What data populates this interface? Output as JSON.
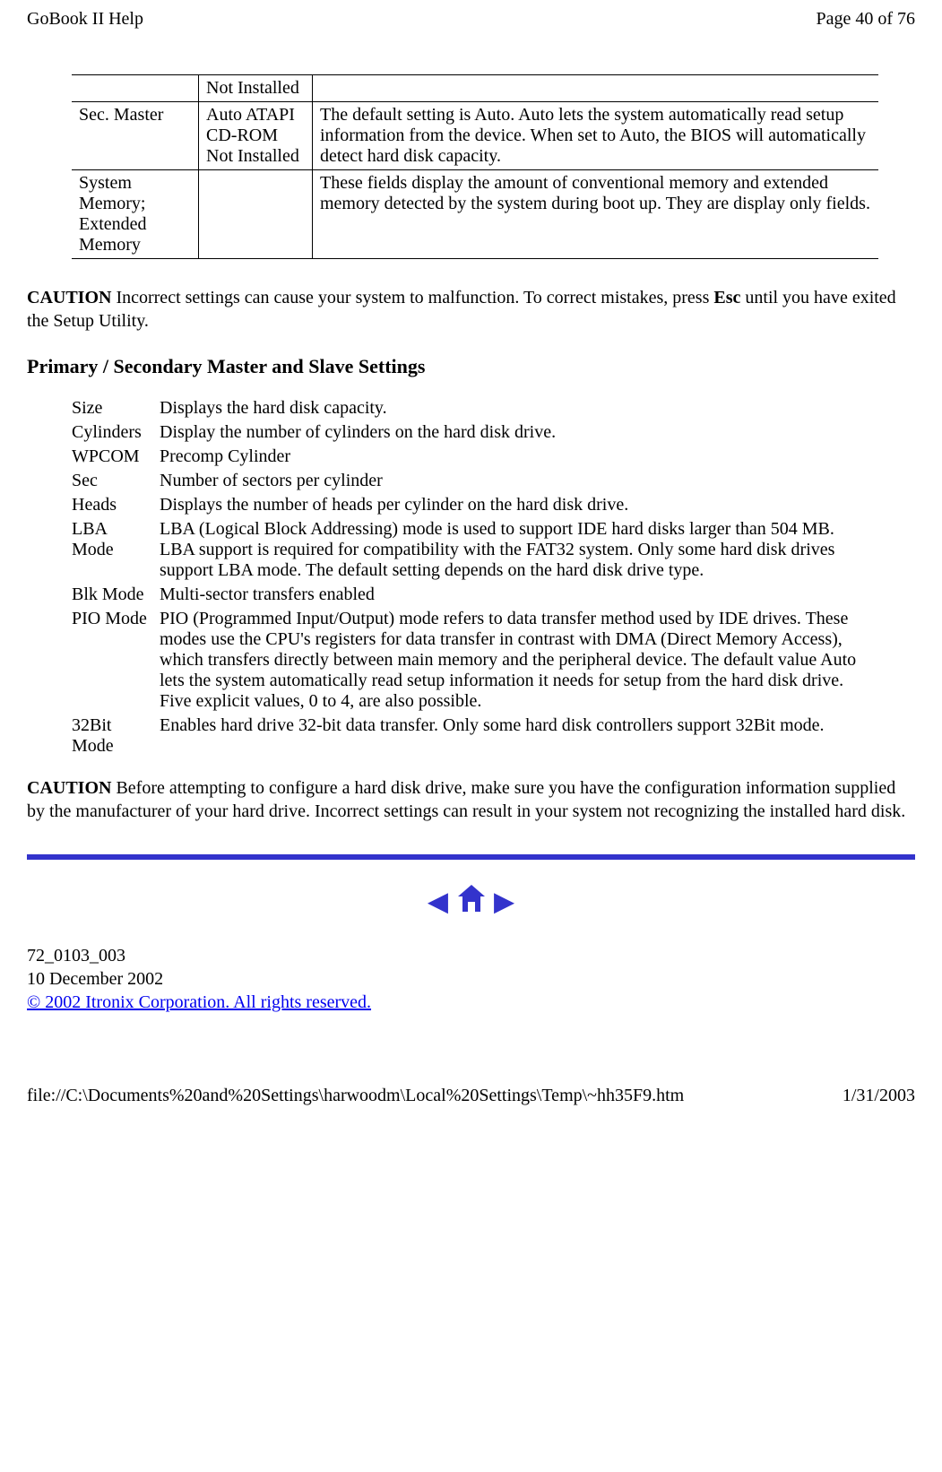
{
  "header": {
    "left": "GoBook II Help",
    "right": "Page 40 of 76"
  },
  "bios_table": {
    "rows": [
      {
        "col1": "",
        "col2": "Not Installed",
        "col3": ""
      },
      {
        "col1": "Sec. Master",
        "col2": "Auto ATAPI CD-ROM Not Installed",
        "col3": "The default setting is Auto.  Auto lets the system automatically read setup information from the device.  When set to Auto, the BIOS will automatically detect hard disk capacity."
      },
      {
        "col1": "System Memory; Extended Memory",
        "col2": "",
        "col3": "These fields display the amount of conventional memory and extended memory detected by the system during boot up. They are display only fields."
      }
    ]
  },
  "caution1": {
    "label": "CAUTION",
    "text": "  Incorrect settings can cause your system to malfunction.  To correct mistakes, press ",
    "key": "Esc",
    "text2": " until you have exited the Setup Utility."
  },
  "section_heading": "Primary / Secondary Master and Slave Settings",
  "settings_table": {
    "rows": [
      {
        "label": "Size",
        "desc": "Displays the hard disk capacity."
      },
      {
        "label": "Cylinders",
        "desc": "Display the number of cylinders on the hard disk drive."
      },
      {
        "label": "WPCOM",
        "desc": "Precomp Cylinder"
      },
      {
        "label": "Sec",
        "desc": "Number of sectors per cylinder"
      },
      {
        "label": "Heads",
        "desc": "Displays the number of heads per cylinder on the hard disk drive."
      },
      {
        "label": "LBA Mode",
        "desc": "LBA (Logical Block Addressing) mode is used to support IDE hard disks larger than 504 MB.  LBA support is required for compatibility with the FAT32 system.  Only some hard disk drives support LBA mode.  The default setting depends on the hard disk drive type."
      },
      {
        "label": "Blk Mode",
        "desc": "Multi-sector transfers enabled"
      },
      {
        "label": "PIO Mode",
        "desc": "PIO (Programmed Input/Output) mode refers to data transfer method used by IDE drives.  These modes use the CPU's registers for data transfer in contrast with DMA (Direct Memory Access), which transfers directly between main memory and the peripheral device.  The default value Auto lets the system automatically read setup information it needs for setup from the hard disk drive.  Five explicit values, 0 to 4, are also possible."
      },
      {
        "label": "32Bit Mode",
        "desc": "Enables hard drive 32-bit data transfer.  Only some hard disk controllers support 32Bit mode."
      }
    ]
  },
  "caution2": {
    "label": "CAUTION",
    "text": "  Before attempting to configure a hard disk drive, make sure you have the configuration information supplied by the manufacturer of your hard drive.  Incorrect settings can result in your system not recognizing the installed hard disk."
  },
  "footer": {
    "doc_number": "72_0103_003",
    "date": "10 December 2002",
    "copyright": "© 2002 Itronix Corporation.  All rights reserved."
  },
  "bottom": {
    "path": "file://C:\\Documents%20and%20Settings\\harwoodm\\Local%20Settings\\Temp\\~hh35F9.htm",
    "date": "1/31/2003"
  }
}
